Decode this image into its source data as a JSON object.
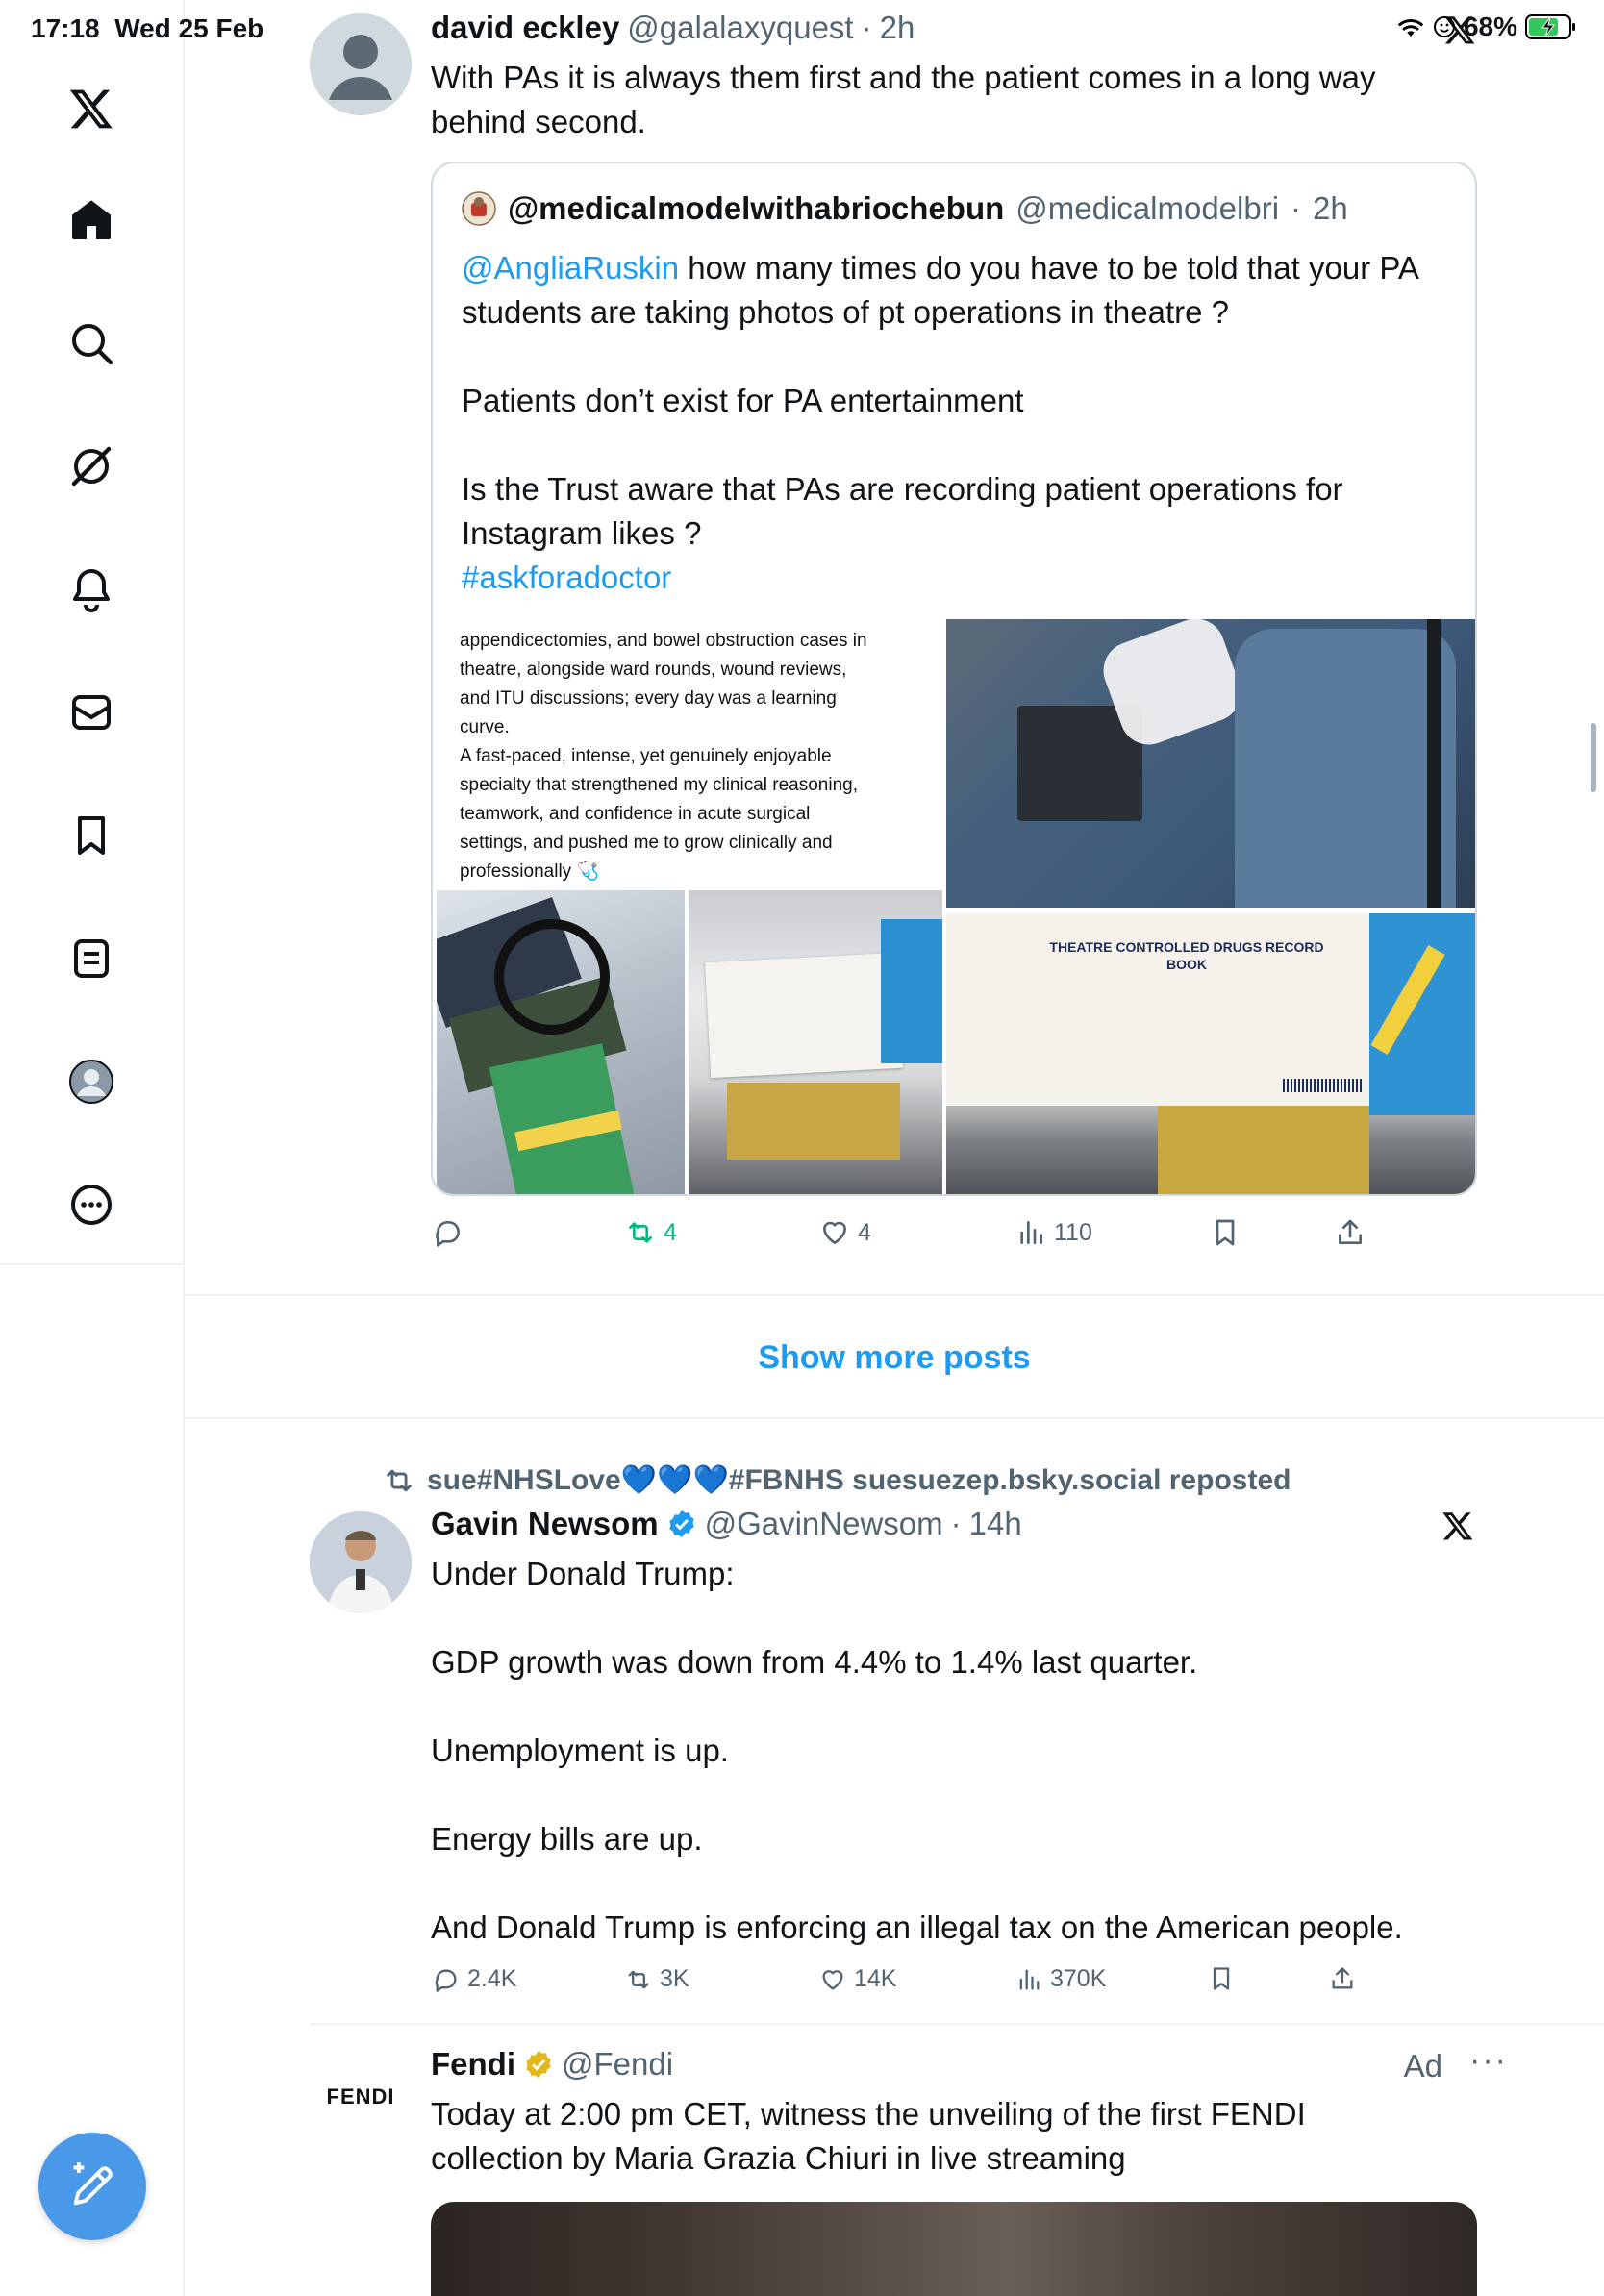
{
  "status_bar": {
    "time": "17:18",
    "date": "Wed 25 Feb",
    "battery": "68%"
  },
  "sidebar": {
    "items": [
      {
        "name": "x-logo-icon"
      },
      {
        "name": "home-icon"
      },
      {
        "name": "search-icon"
      },
      {
        "name": "grok-icon"
      },
      {
        "name": "notifications-bell-icon"
      },
      {
        "name": "messages-icon"
      },
      {
        "name": "bookmarks-icon"
      },
      {
        "name": "lists-icon"
      },
      {
        "name": "profile-avatar-icon"
      },
      {
        "name": "more-options-icon"
      }
    ]
  },
  "tweet1": {
    "display_name": "david eckley",
    "handle": "@galalaxyquest",
    "time": "2h",
    "text_line1": "With PAs it is always them first and the patient comes in a long way",
    "text_line2": "behind second.",
    "quote": {
      "display_name": "@medicalmodelwithabriochebun",
      "handle": "@medicalmodelbri",
      "time": "2h",
      "mention": "@AngliaRuskin",
      "line1_rest": " how many times do you have to be told that your PA",
      "line2": "students are taking photos of pt operations in theatre ?",
      "line3": "Patients don’t exist for PA entertainment",
      "line4": "Is the Trust aware that PAs are recording  patient operations for",
      "line5": "Instagram likes ?",
      "hashtag": "#askforadoctor",
      "image_text": [
        "appendicectomies, and bowel obstruction cases in",
        "theatre, alongside ward rounds, wound reviews,",
        "and ITU discussions; every day was a learning",
        "curve.",
        "A fast-paced, intense, yet genuinely enjoyable",
        "specialty that strengthened my clinical reasoning,",
        "teamwork, and confidence in acute surgical",
        "settings, and pushed me to grow clinically and",
        "professionally 🩺"
      ],
      "record_book_label": "THEATRE CONTROLLED DRUGS RECORD BOOK"
    },
    "actions": {
      "reposts": "4",
      "likes": "4",
      "views": "110"
    }
  },
  "show_more": "Show more posts",
  "repost_banner": "sue#NHSLove💙💙💙#FBNHS suesuezep.bsky.social reposted",
  "tweet2": {
    "display_name": "Gavin Newsom",
    "handle": "@GavinNewsom",
    "time": "14h",
    "lines": [
      "Under Donald Trump:",
      "GDP growth was down from 4.4% to 1.4% last quarter.",
      "Unemployment is up.",
      "Energy bills are up.",
      "And Donald Trump is enforcing an illegal tax on the American people."
    ],
    "actions": {
      "replies": "2.4K",
      "reposts": "3K",
      "likes": "14K",
      "views": "370K"
    }
  },
  "tweet3": {
    "display_name": "Fendi",
    "handle": "@Fendi",
    "ad_label": "Ad",
    "logo_text": "FENDI",
    "text_line1": "Today at 2:00 pm CET, witness the unveiling of the first FENDI",
    "text_line2": "collection by Maria Grazia Chiuri in live streaming"
  },
  "colors": {
    "accent": "#1d9bf0",
    "fab": "#4a99e9",
    "text": "#0f1419",
    "muted": "#536471",
    "verified": "#1d9bf0",
    "gold_verified": "#e2b719"
  }
}
